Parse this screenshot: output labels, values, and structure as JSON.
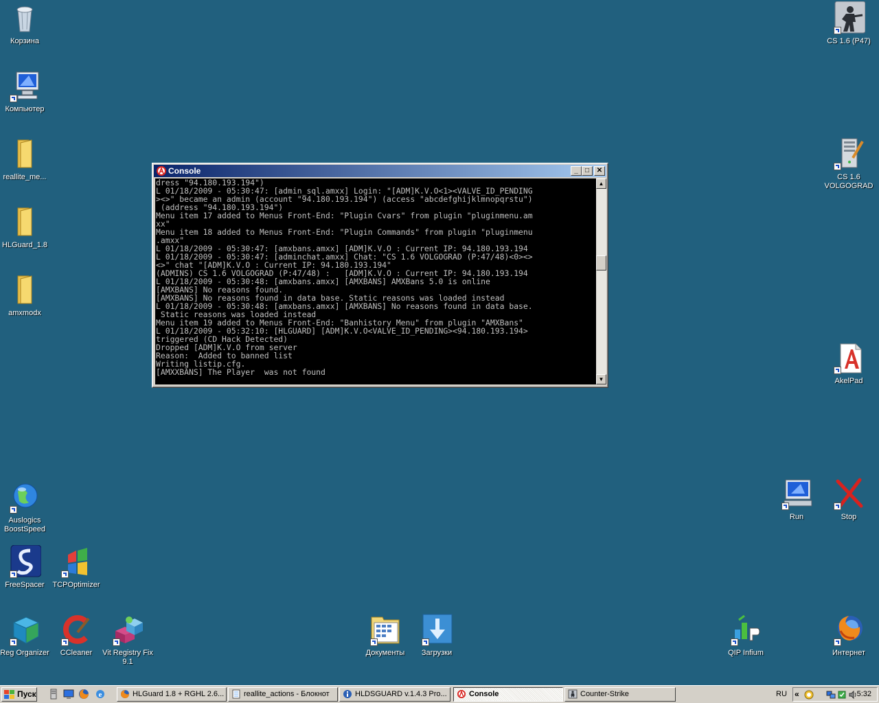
{
  "desktop": {
    "icons_left": [
      {
        "label": "Корзина",
        "icon": "recycle-bin-icon"
      },
      {
        "label": "Компьютер",
        "icon": "computer-icon"
      },
      {
        "label": "reallite_me...",
        "icon": "folder-icon"
      },
      {
        "label": "HLGuard_1.8",
        "icon": "folder-icon"
      },
      {
        "label": "amxmodx",
        "icon": "folder-icon"
      },
      {
        "label": "Auslogics BoostSpeed",
        "icon": "globe-icon"
      },
      {
        "label": "FreeSpacer",
        "icon": "freespacer-icon"
      },
      {
        "label": "TCPOptimizer",
        "icon": "tcpoptimizer-icon"
      },
      {
        "label": "Reg Organizer",
        "icon": "reg-organizer-icon"
      },
      {
        "label": "CCleaner",
        "icon": "ccleaner-icon"
      },
      {
        "label": "Vit Registry Fix 9.1",
        "icon": "vit-registry-icon"
      }
    ],
    "icons_center": [
      {
        "label": "Документы",
        "icon": "documents-icon"
      },
      {
        "label": "Загрузки",
        "icon": "downloads-icon"
      }
    ],
    "icons_right": [
      {
        "label": "CS 1.6 (P47)",
        "icon": "counter-strike-icon"
      },
      {
        "label": "CS 1.6 VOLGOGRAD",
        "icon": "server-icon"
      },
      {
        "label": "AkelPad",
        "icon": "akelpad-icon"
      },
      {
        "label": "Run",
        "icon": "run-icon"
      },
      {
        "label": "Stop",
        "icon": "stop-icon"
      },
      {
        "label": "QIP Infium",
        "icon": "qip-icon"
      },
      {
        "label": "Интернет",
        "icon": "firefox-icon"
      }
    ]
  },
  "console": {
    "title": "Console",
    "lines": [
      "dress \"94.180.193.194\")",
      "L 01/18/2009 - 05:30:47: [admin_sql.amxx] Login: \"[ADM]K.V.O<1><VALVE_ID_PENDING",
      "><>\" became an admin (account \"94.180.193.194\") (access \"abcdefghijklmnopqrstu\")",
      " (address \"94.180.193.194\")",
      "Menu item 17 added to Menus Front-End: \"Plugin Cvars\" from plugin \"pluginmenu.am",
      "xx\"",
      "Menu item 18 added to Menus Front-End: \"Plugin Commands\" from plugin \"pluginmenu",
      ".amxx\"",
      "L 01/18/2009 - 05:30:47: [amxbans.amxx] [ADM]K.V.O : Current IP: 94.180.193.194",
      "L 01/18/2009 - 05:30:47: [adminchat.amxx] Chat: \"CS 1.6 VOLGOGRAD (P:47/48)<0><>",
      "<>\" chat \"[ADM]K.V.O : Current IP: 94.180.193.194\"",
      "(ADMINS) CS 1.6 VOLGOGRAD (P:47/48) :   [ADM]K.V.O : Current IP: 94.180.193.194",
      "L 01/18/2009 - 05:30:48: [amxbans.amxx] [AMXBANS] AMXBans 5.0 is online",
      "[AMXBANS] No reasons found.",
      "[AMXBANS] No reasons found in data base. Static reasons was loaded instead",
      "L 01/18/2009 - 05:30:48: [amxbans.amxx] [AMXBANS] No reasons found in data base.",
      " Static reasons was loaded instead",
      "Menu item 19 added to Menus Front-End: \"Banhistory Menu\" from plugin \"AMXBans\"",
      "L 01/18/2009 - 05:32:10: [HLGUARD] [ADM]K.V.O<VALVE_ID_PENDING><94.180.193.194>",
      "triggered (CD Hack Detected)",
      "Dropped [ADM]K.V.O from server",
      "Reason:  Added to banned list",
      "Writing listip.cfg.",
      "[AMXXBANS] The Player  was not found"
    ]
  },
  "taskbar": {
    "start_label": "Пуск",
    "tasks": [
      {
        "label": "HLGuard 1.8 + RGHL 2.6...",
        "active": false
      },
      {
        "label": "reallite_actions - Блокнот",
        "active": false
      },
      {
        "label": "HLDSGUARD v.1.4.3 Pro...",
        "active": false
      },
      {
        "label": "Console",
        "active": true
      },
      {
        "label": "Counter-Strike",
        "active": false
      }
    ],
    "language": "RU",
    "tray_chevron": "«",
    "clock": "5:32"
  },
  "colors": {
    "desktop": "#21607e",
    "titlebar_start": "#0a246a",
    "titlebar_end": "#a6caf0",
    "console_bg": "#000000",
    "console_fg": "#c0c0c0"
  }
}
